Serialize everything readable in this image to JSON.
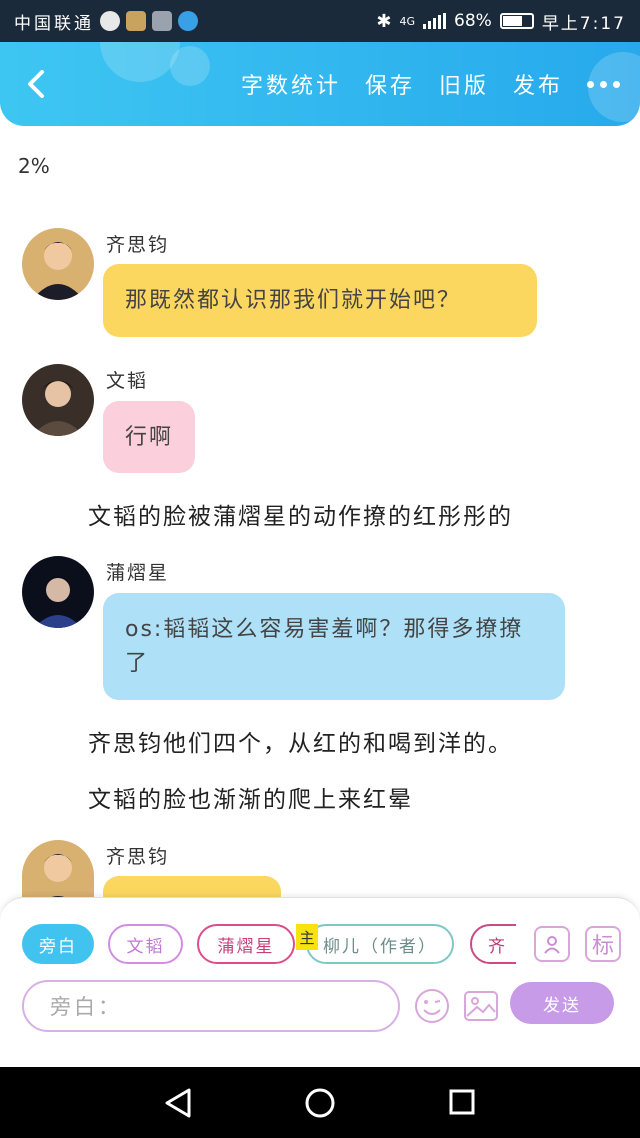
{
  "status_bar": {
    "carrier": "中国联通",
    "network": "4G",
    "battery": "68%",
    "battery_level": 0.68,
    "time": "早上7:17"
  },
  "header": {
    "back_icon": "chevron-left-icon",
    "actions": [
      "字数统计",
      "保存",
      "旧版",
      "发布"
    ],
    "more_icon": "more-dots-icon"
  },
  "progress_text": "2%",
  "messages": [
    {
      "name": "齐思钧",
      "text": "那既然都认识那我们就开始吧？"
    },
    {
      "name": "文韬",
      "text": "行啊"
    },
    {
      "narration": "文韬的脸被蒲熠星的动作撩的红彤彤的"
    },
    {
      "name": "蒲熠星",
      "text": "os:韬韬这么容易害羞啊？那得多撩撩了"
    },
    {
      "narration": "齐思钧他们四个，从红的和喝到洋的。"
    },
    {
      "narration": "文韬的脸也渐渐的爬上来红晕"
    },
    {
      "name": "齐思钧"
    }
  ],
  "colors": {
    "header_gradient_start": "#3ec6f2",
    "header_gradient_end": "#27a9ec",
    "yellow_bubble": "#fbd760",
    "pink_bubble": "#fbcfdc",
    "blue_bubble": "#aee0f8",
    "send_button": "#c79be8"
  },
  "composer": {
    "chips": [
      "旁白",
      "文韬",
      "蒲熠星",
      "主",
      "柳儿（作者）",
      "齐"
    ],
    "role_icon": "person-card-icon",
    "tag_icon": "tag-标-icon",
    "tag_label": "标",
    "input_placeholder": "旁白：",
    "emoji_icon": "emoji-icon",
    "image_icon": "image-icon",
    "send_label": "发送"
  },
  "nav_bar": {
    "back": "back-triangle-icon",
    "home": "home-circle-icon",
    "recents": "recents-square-icon"
  }
}
